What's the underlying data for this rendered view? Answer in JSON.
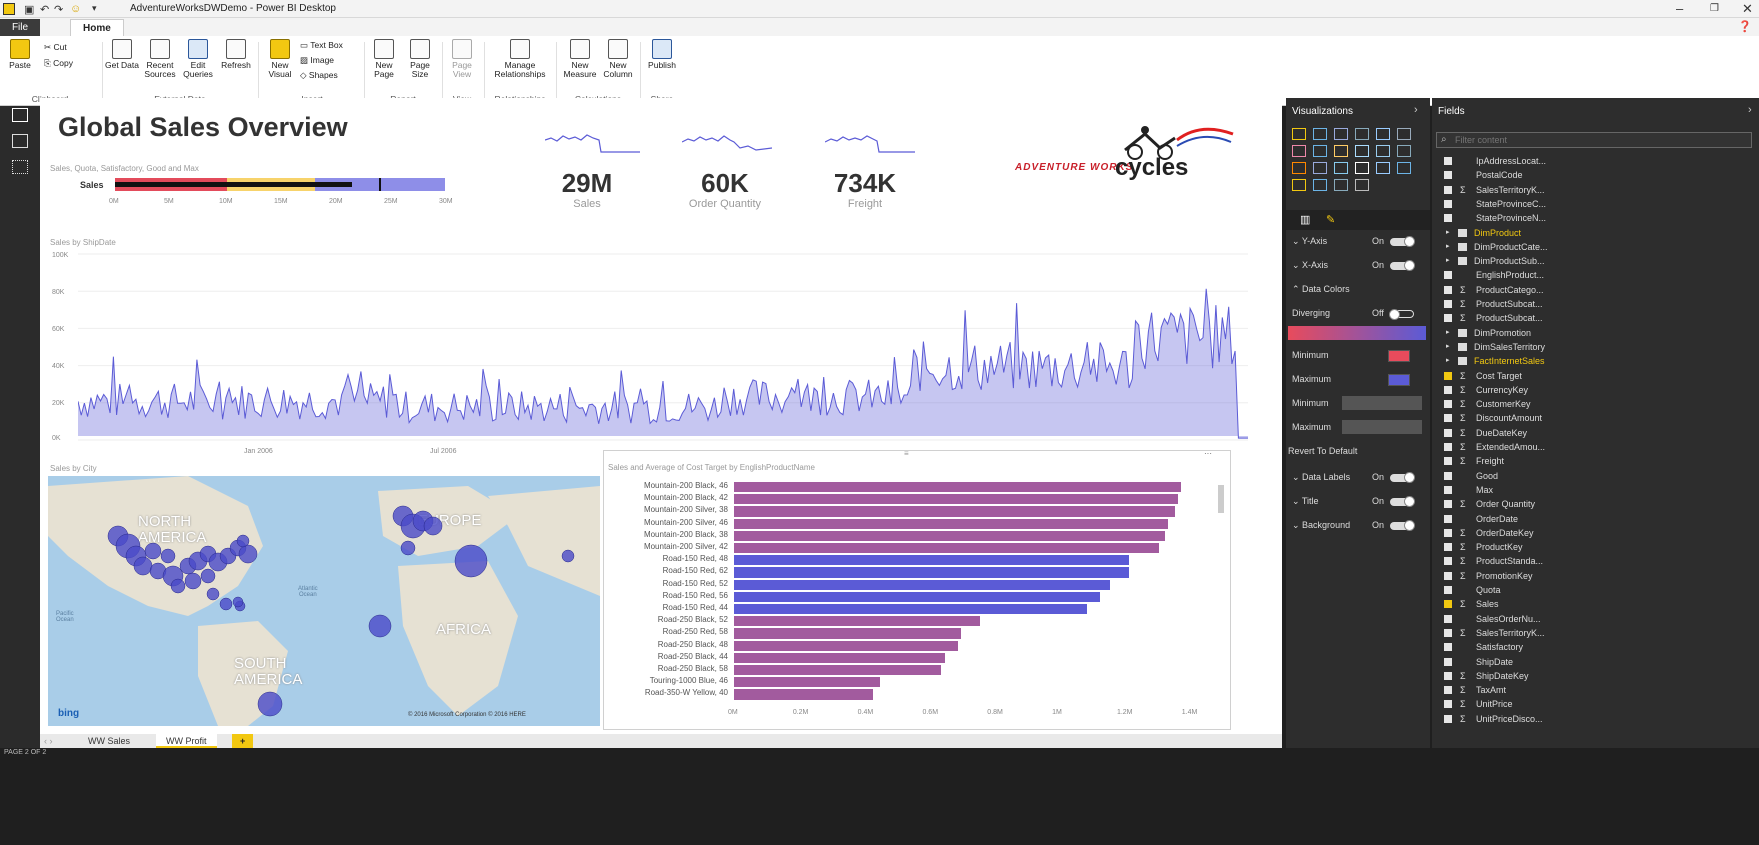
{
  "window": {
    "title": "AdventureWorksDWDemo - Power BI Desktop"
  },
  "ribbon": {
    "tabs": [
      "File",
      "Home"
    ],
    "buttons": {
      "paste": "Paste",
      "cut": "Cut",
      "copy": "Copy",
      "get_data": "Get Data",
      "recent_sources": "Recent Sources",
      "edit_queries": "Edit Queries",
      "refresh": "Refresh",
      "new_visual": "New Visual",
      "text_box": "Text Box",
      "image": "Image",
      "shapes": "Shapes",
      "new_page": "New Page",
      "page_size": "Page Size",
      "page_view": "Page View",
      "manage_relationships": "Manage Relationships",
      "new_measure": "New Measure",
      "new_column": "New Column",
      "publish": "Publish"
    },
    "groups": [
      "Clipboard",
      "External Data",
      "Insert",
      "Report",
      "View",
      "Relationships",
      "Calculations",
      "Share"
    ]
  },
  "report": {
    "title": "Global Sales Overview",
    "bullet": {
      "caption": "Sales, Quota, Satisfactory, Good and Max",
      "label": "Sales",
      "ticks": [
        "0M",
        "5M",
        "10M",
        "15M",
        "20M",
        "25M",
        "30M"
      ],
      "value_m": 21.5,
      "target_m": 24,
      "max_m": 30
    },
    "kpis": [
      {
        "value": "29M",
        "label": "Sales"
      },
      {
        "value": "60K",
        "label": "Order Quantity"
      },
      {
        "value": "734K",
        "label": "Freight"
      }
    ],
    "logo": {
      "line1": "ADVENTURE WORKS",
      "line2": "cycles"
    },
    "area_chart": {
      "title": "Sales by ShipDate",
      "y_ticks": [
        "100K",
        "80K",
        "60K",
        "40K",
        "20K",
        "0K"
      ],
      "x_ticks": [
        "Jan 2006",
        "Jul 2006"
      ]
    },
    "map": {
      "title": "Sales by City",
      "labels": {
        "north_america": "NORTH\nAMERICA",
        "europe": "EUROPE",
        "africa": "AFRICA",
        "south_america": "SOUTH\nAMERICA",
        "atlantic": "Atlantic\nOcean",
        "pacific": "Pacific\nOcean"
      },
      "bing": "bing",
      "copyright": "© 2016 Microsoft Corporation   © 2016 HERE"
    },
    "bar_chart": {
      "title": "Sales and Average of Cost Target by EnglishProductName",
      "x_ticks": [
        "0M",
        "0.2M",
        "0.4M",
        "0.6M",
        "0.8M",
        "1M",
        "1.2M",
        "1.4M"
      ]
    }
  },
  "page_tabs": [
    "WW Sales",
    "WW Profit",
    "+"
  ],
  "status": {
    "page": "PAGE 2 OF 2"
  },
  "viz_pane": {
    "title": "Visualizations",
    "format_rows": [
      {
        "label": "Y-Axis",
        "state": "On"
      },
      {
        "label": "X-Axis",
        "state": "On"
      }
    ],
    "data_colors": "Data Colors",
    "diverging": {
      "label": "Diverging",
      "state": "Off"
    },
    "minimum": "Minimum",
    "maximum": "Maximum",
    "min2": "Minimum",
    "max2": "Maximum",
    "revert": "Revert To Default",
    "more_rows": [
      {
        "label": "Data Labels",
        "state": "On"
      },
      {
        "label": "Title",
        "state": "On"
      },
      {
        "label": "Background",
        "state": "On"
      }
    ],
    "colors": {
      "min": "#e84b5c",
      "max": "#5b5bd6"
    }
  },
  "fields_pane": {
    "title": "Fields",
    "search_placeholder": "Filter content",
    "fields": [
      {
        "name": "IpAddressLocat...",
        "checked": false,
        "table": false,
        "sigma": false
      },
      {
        "name": "PostalCode",
        "checked": false,
        "table": false,
        "sigma": false
      },
      {
        "name": "SalesTerritoryK...",
        "checked": false,
        "table": false,
        "sigma": true
      },
      {
        "name": "StateProvinceC...",
        "checked": false,
        "table": false,
        "sigma": false
      },
      {
        "name": "StateProvinceN...",
        "checked": false,
        "table": false,
        "sigma": false
      },
      {
        "name": "DimProduct",
        "checked": false,
        "table": true,
        "sigma": false,
        "highlight": true
      },
      {
        "name": "DimProductCate...",
        "checked": false,
        "table": true,
        "sigma": false
      },
      {
        "name": "DimProductSub...",
        "checked": false,
        "table": true,
        "sigma": false
      },
      {
        "name": "EnglishProduct...",
        "checked": false,
        "table": false,
        "sigma": false
      },
      {
        "name": "ProductCatego...",
        "checked": false,
        "table": false,
        "sigma": true
      },
      {
        "name": "ProductSubcat...",
        "checked": false,
        "table": false,
        "sigma": true
      },
      {
        "name": "ProductSubcat...",
        "checked": false,
        "table": false,
        "sigma": true
      },
      {
        "name": "DimPromotion",
        "checked": false,
        "table": true,
        "sigma": false
      },
      {
        "name": "DimSalesTerritory",
        "checked": false,
        "table": true,
        "sigma": false
      },
      {
        "name": "FactInternetSales",
        "checked": false,
        "table": true,
        "sigma": false,
        "highlight": true
      },
      {
        "name": "Cost Target",
        "checked": true,
        "table": false,
        "sigma": true
      },
      {
        "name": "CurrencyKey",
        "checked": false,
        "table": false,
        "sigma": true
      },
      {
        "name": "CustomerKey",
        "checked": false,
        "table": false,
        "sigma": true
      },
      {
        "name": "DiscountAmount",
        "checked": false,
        "table": false,
        "sigma": true
      },
      {
        "name": "DueDateKey",
        "checked": false,
        "table": false,
        "sigma": true
      },
      {
        "name": "ExtendedAmou...",
        "checked": false,
        "table": false,
        "sigma": true
      },
      {
        "name": "Freight",
        "checked": false,
        "table": false,
        "sigma": true
      },
      {
        "name": "Good",
        "checked": false,
        "table": false,
        "sigma": false
      },
      {
        "name": "Max",
        "checked": false,
        "table": false,
        "sigma": false
      },
      {
        "name": "Order Quantity",
        "checked": false,
        "table": false,
        "sigma": true
      },
      {
        "name": "OrderDate",
        "checked": false,
        "table": false,
        "sigma": false
      },
      {
        "name": "OrderDateKey",
        "checked": false,
        "table": false,
        "sigma": true
      },
      {
        "name": "ProductKey",
        "checked": false,
        "table": false,
        "sigma": true
      },
      {
        "name": "ProductStanda...",
        "checked": false,
        "table": false,
        "sigma": true
      },
      {
        "name": "PromotionKey",
        "checked": false,
        "table": false,
        "sigma": true
      },
      {
        "name": "Quota",
        "checked": false,
        "table": false,
        "sigma": false
      },
      {
        "name": "Sales",
        "checked": true,
        "table": false,
        "sigma": true
      },
      {
        "name": "SalesOrderNu...",
        "checked": false,
        "table": false,
        "sigma": false
      },
      {
        "name": "SalesTerritoryK...",
        "checked": false,
        "table": false,
        "sigma": true
      },
      {
        "name": "Satisfactory",
        "checked": false,
        "table": false,
        "sigma": false
      },
      {
        "name": "ShipDate",
        "checked": false,
        "table": false,
        "sigma": false
      },
      {
        "name": "ShipDateKey",
        "checked": false,
        "table": false,
        "sigma": true
      },
      {
        "name": "TaxAmt",
        "checked": false,
        "table": false,
        "sigma": true
      },
      {
        "name": "UnitPrice",
        "checked": false,
        "table": false,
        "sigma": true
      },
      {
        "name": "UnitPriceDisco...",
        "checked": false,
        "table": false,
        "sigma": true
      }
    ]
  },
  "chart_data": [
    {
      "type": "bar",
      "title": "Sales and Average of Cost Target by EnglishProductName",
      "orientation": "horizontal",
      "categories": [
        "Mountain-200 Black, 46",
        "Mountain-200 Black, 42",
        "Mountain-200 Silver, 38",
        "Mountain-200 Silver, 46",
        "Mountain-200 Black, 38",
        "Mountain-200 Silver, 42",
        "Road-150 Red, 48",
        "Road-150 Red, 62",
        "Road-150 Red, 52",
        "Road-150 Red, 56",
        "Road-150 Red, 44",
        "Road-250 Black, 52",
        "Road-250 Red, 58",
        "Road-250 Black, 48",
        "Road-250 Black, 44",
        "Road-250 Black, 58",
        "Touring-1000 Blue, 46",
        "Road-350-W Yellow, 40"
      ],
      "values": [
        1.38,
        1.37,
        1.36,
        1.34,
        1.33,
        1.31,
        1.22,
        1.22,
        1.16,
        1.13,
        1.09,
        0.76,
        0.7,
        0.69,
        0.65,
        0.64,
        0.45,
        0.43
      ],
      "highlight_indices": [
        6,
        7,
        8,
        9,
        10
      ],
      "x_unit": "M",
      "xlim": [
        0,
        1.45
      ],
      "colors": {
        "default": "#a25b9e",
        "highlight": "#5b5bd6"
      }
    },
    {
      "type": "area",
      "title": "Sales by ShipDate",
      "ylim": [
        0,
        100
      ],
      "y_unit": "K",
      "segments": [
        {
          "from_index": 0,
          "to_index": 100,
          "level_k": 18,
          "spread_k": 10
        },
        {
          "from_index": 100,
          "to_index": 200,
          "level_k": 15,
          "spread_k": 9
        },
        {
          "from_index": 200,
          "to_index": 260,
          "level_k": 20,
          "spread_k": 10
        },
        {
          "from_index": 260,
          "to_index": 330,
          "level_k": 35,
          "spread_k": 14
        },
        {
          "from_index": 330,
          "to_index": 365,
          "level_k": 50,
          "spread_k": 18
        }
      ],
      "color": "#5b5bd6"
    }
  ]
}
